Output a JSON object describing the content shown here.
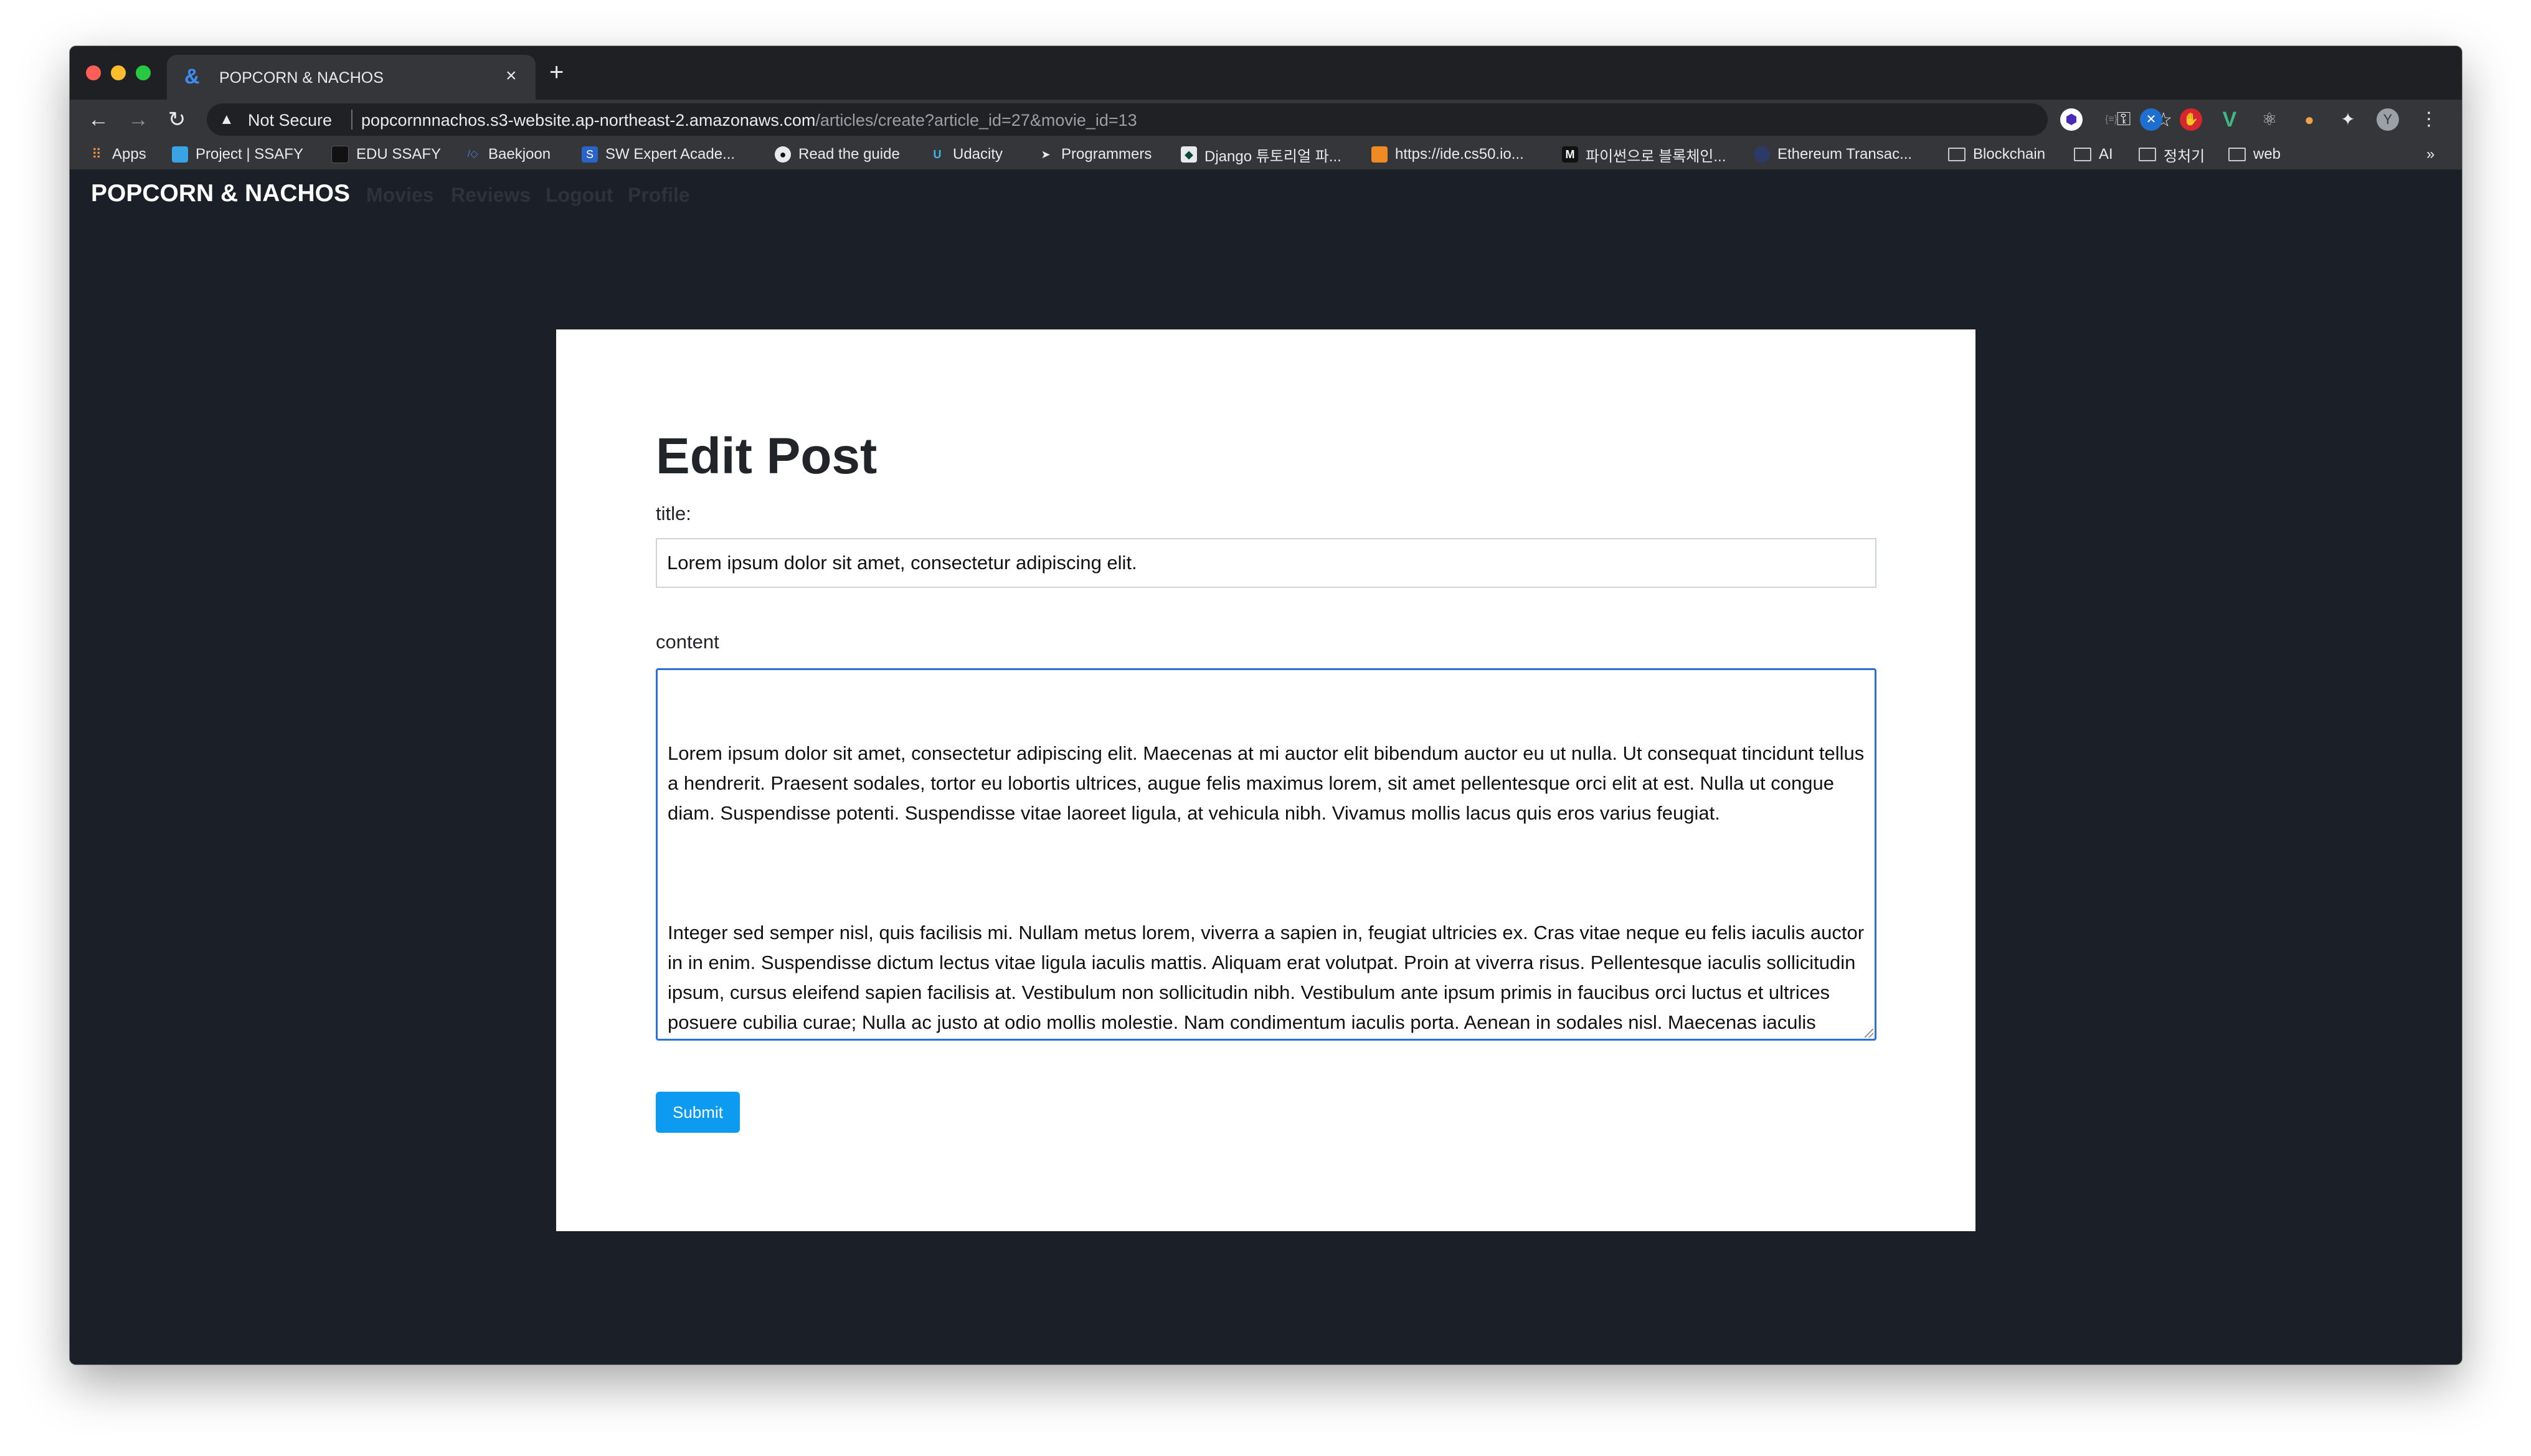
{
  "browser": {
    "tab": {
      "title": "POPCORN & NACHOS",
      "favicon": "&",
      "close": "×"
    },
    "new_tab": "+",
    "address": {
      "security_label": "Not Secure",
      "host": "popcornnnachos.s3-website.ap-northeast-2.amazonaws.com",
      "path": "/articles/create?article_id=27&movie_id=13"
    },
    "profile_initial": "Y",
    "bookmarks": [
      {
        "label": "Apps",
        "icon": "apps-grid-icon"
      },
      {
        "label": "Project | SSAFY",
        "icon": "ssafy-icon"
      },
      {
        "label": "EDU SSAFY",
        "icon": "edu-ssafy-icon"
      },
      {
        "label": "Baekjoon",
        "icon": "baekjoon-icon"
      },
      {
        "label": "SW Expert Acade...",
        "icon": "swea-icon",
        "icon_text": "S"
      },
      {
        "label": "Read the guide",
        "icon": "github-icon"
      },
      {
        "label": "Udacity",
        "icon": "udacity-icon",
        "icon_text": "U"
      },
      {
        "label": "Programmers",
        "icon": "programmers-icon"
      },
      {
        "label": "Django 튜토리얼 파...",
        "icon": "django-icon"
      },
      {
        "label": "https://ide.cs50.io...",
        "icon": "cs50-icon"
      },
      {
        "label": "파이썬으로 블록체인...",
        "icon": "medium-icon",
        "icon_text": "M"
      },
      {
        "label": "Ethereum Transac...",
        "icon": "ethereum-icon"
      },
      {
        "label": "Blockchain",
        "icon": "folder-icon"
      },
      {
        "label": "AI",
        "icon": "folder-icon"
      },
      {
        "label": "정처기",
        "icon": "folder-icon"
      },
      {
        "label": "web",
        "icon": "folder-icon"
      }
    ],
    "overflow": "»"
  },
  "navbar": {
    "brand": "POPCORN & NACHOS",
    "links": [
      "Movies",
      "Reviews",
      "Logout",
      "Profile"
    ]
  },
  "form": {
    "heading": "Edit Post",
    "title_label": "title:",
    "title_value": "Lorem ipsum dolor sit amet, consectetur adipiscing elit.",
    "content_label": "content",
    "content_paragraphs": [
      "Lorem ipsum dolor sit amet, consectetur adipiscing elit. Maecenas at mi auctor elit bibendum auctor eu ut nulla. Ut consequat tincidunt tellus a hendrerit. Praesent sodales, tortor eu lobortis ultrices, augue felis maximus lorem, sit amet pellentesque orci elit at est. Nulla ut congue diam. Suspendisse potenti. Suspendisse vitae laoreet ligula, at vehicula nibh. Vivamus mollis lacus quis eros varius feugiat.",
      "Integer sed semper nisl, quis facilisis mi. Nullam metus lorem, viverra a sapien in, feugiat ultricies ex. Cras vitae neque eu felis iaculis auctor in in enim. Suspendisse dictum lectus vitae ligula iaculis mattis. Aliquam erat volutpat. Proin at viverra risus. Pellentesque iaculis sollicitudin ipsum, cursus eleifend sapien facilisis at. Vestibulum non sollicitudin nibh. Vestibulum ante ipsum primis in faucibus orci luctus et ultrices posuere cubilia curae; Nulla ac justo at odio mollis molestie. Nam condimentum iaculis porta. Aenean in sodales nisl. Maecenas iaculis quam vestibulum tellus fermentum, ut maximus dolor eleifend. Nullam ornare turpis quis varius viverra. Vestibulum pretium quis magna nec efficitur."
    ],
    "submit_label": "Submit"
  },
  "colors": {
    "page_background": "#1b1f27",
    "card_background": "#ffffff",
    "submit_button": "#0d9bf2",
    "nav_link": "#2e333b",
    "textarea_focus_border": "#2d6fd6"
  }
}
